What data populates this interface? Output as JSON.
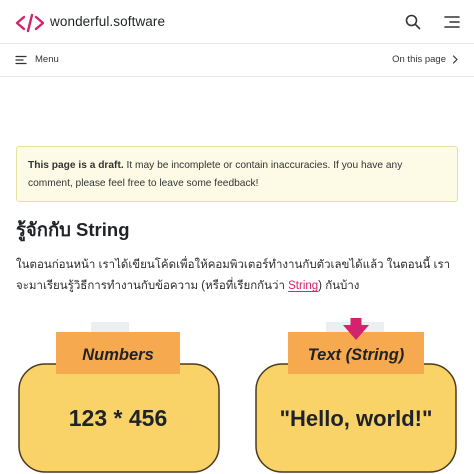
{
  "header": {
    "site_name": "wonderful.software",
    "logo_icon": "code-bracket-logo-icon",
    "brand_color": "#d1246d"
  },
  "subnav": {
    "menu_label": "Menu",
    "on_this_page_label": "On this page"
  },
  "draft_notice": {
    "bold": "This page is a draft.",
    "text": " It may be incomplete or contain inaccuracies. If you have any comment, please feel free to ",
    "link": "leave some feedback",
    "end": "!"
  },
  "page_title": "รู้จักกับ String",
  "intro": {
    "before_link": "ในตอนก่อนหน้า เราได้เขียนโค้ดเพื่อให้คอมพิวเตอร์ทำงานกับตัวเลขได้แล้ว  ในตอนนี้ เราจะมาเรียนรู้วิธีการทำงานกับข้อความ (หรือที่เรียกกันว่า ",
    "link": "String",
    "after_link": ") กันบ้าง"
  },
  "illustration": {
    "left_label": "Numbers",
    "left_value": "123 * 456",
    "right_label": "Text (String)",
    "right_value": "\"Hello, world!\""
  }
}
